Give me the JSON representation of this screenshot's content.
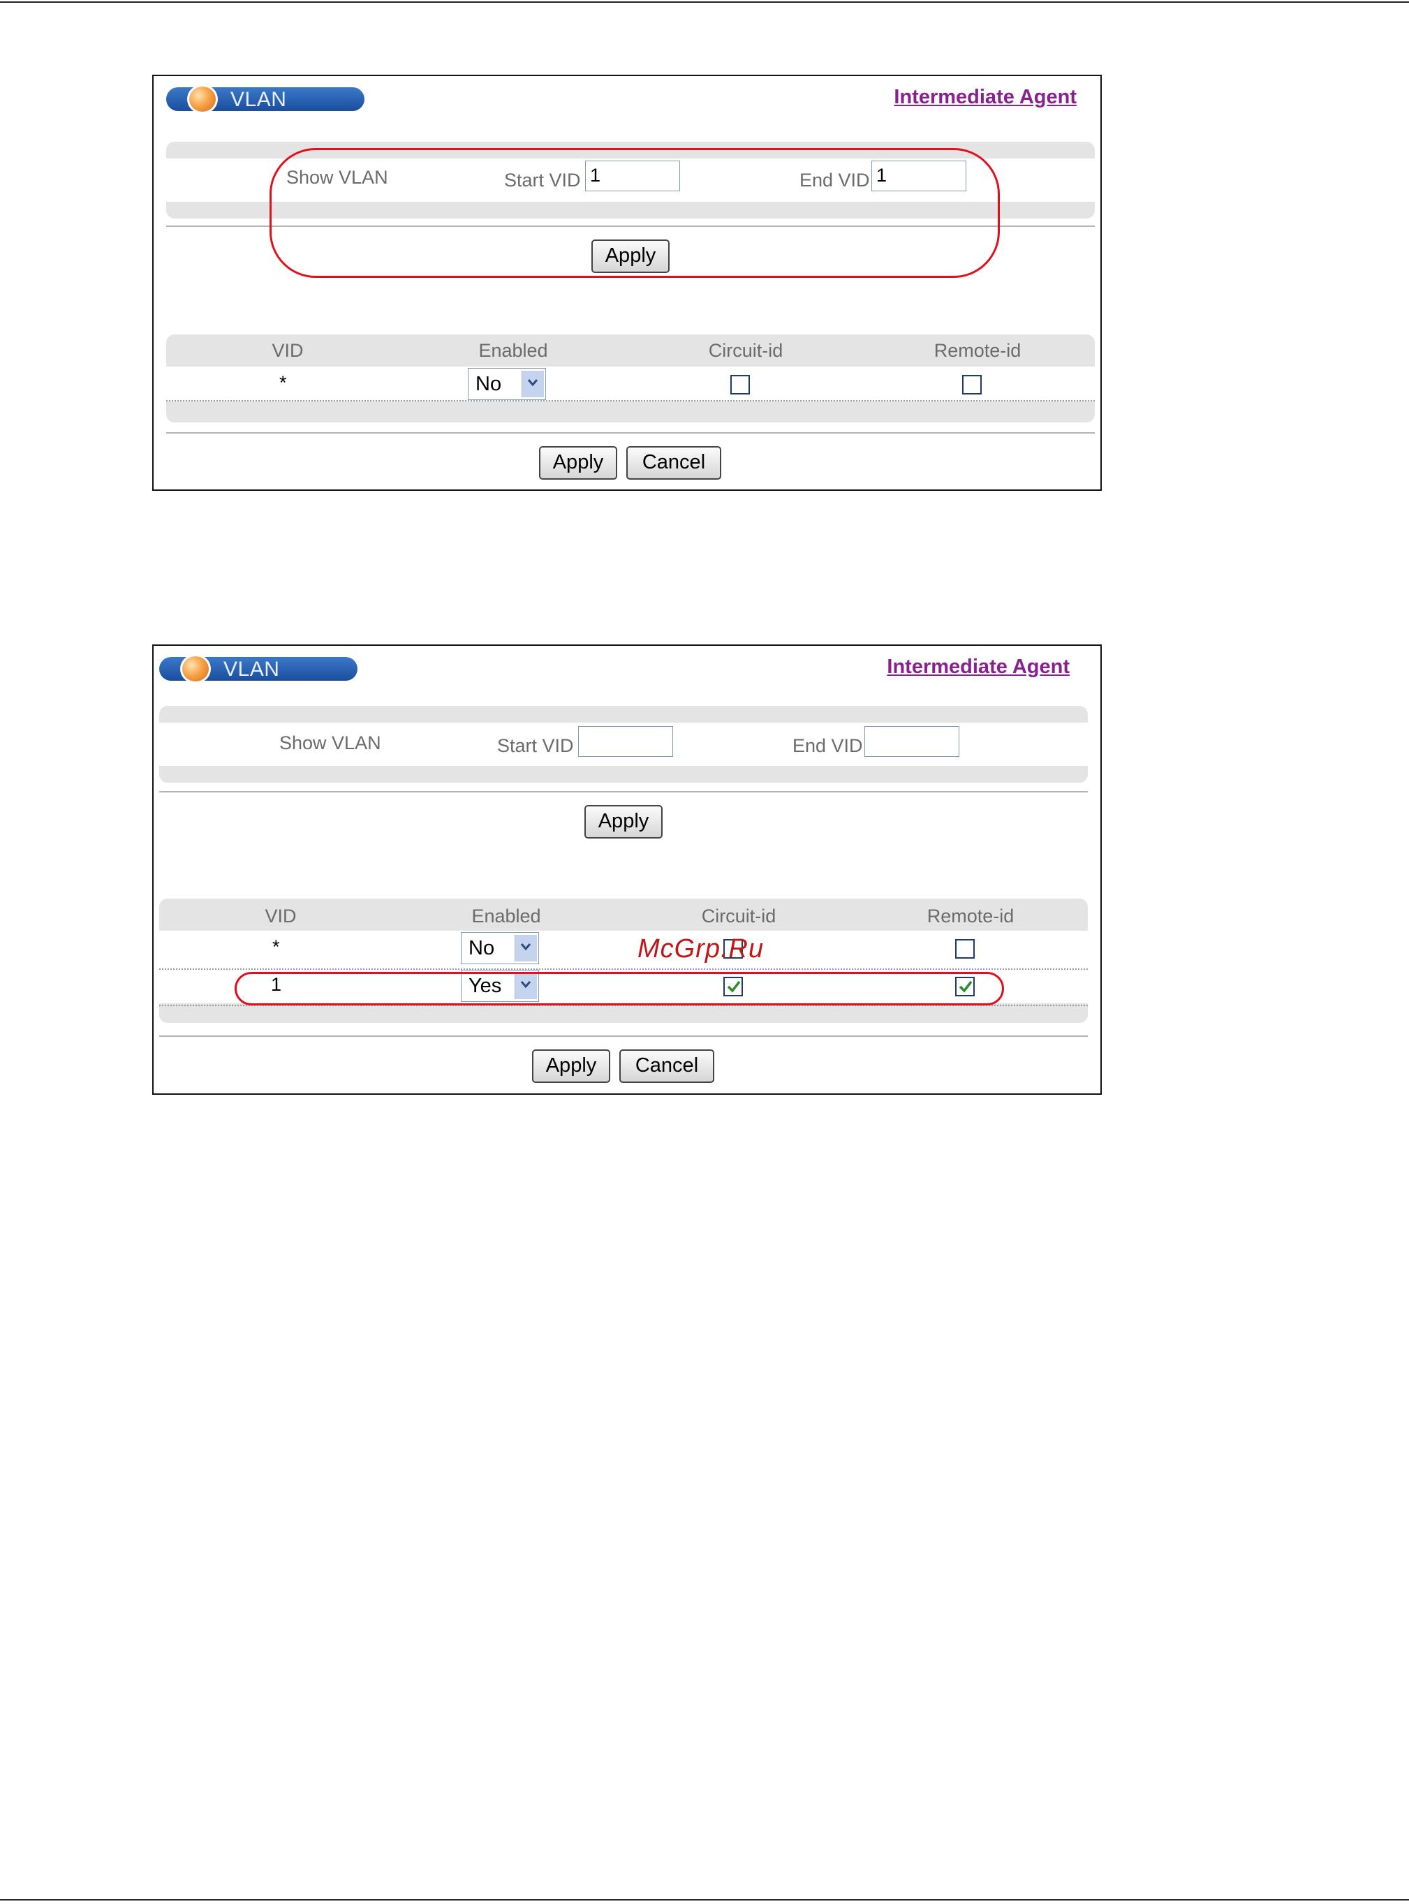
{
  "panels": [
    {
      "header": {
        "title": "VLAN",
        "link": "Intermediate Agent"
      },
      "show_vlan": {
        "label": "Show VLAN",
        "start_label": "Start VID",
        "start_value": "1",
        "end_label": "End VID",
        "end_value": "1",
        "apply": "Apply"
      },
      "table": {
        "columns": [
          "VID",
          "Enabled",
          "Circuit-id",
          "Remote-id"
        ],
        "rows": [
          {
            "vid": "*",
            "enabled": "No",
            "circuit": false,
            "remote": false
          }
        ]
      },
      "buttons": {
        "apply": "Apply",
        "cancel": "Cancel"
      }
    },
    {
      "header": {
        "title": "VLAN",
        "link": "Intermediate Agent"
      },
      "show_vlan": {
        "label": "Show VLAN",
        "start_label": "Start VID",
        "start_value": "",
        "end_label": "End VID",
        "end_value": "",
        "apply": "Apply"
      },
      "table": {
        "columns": [
          "VID",
          "Enabled",
          "Circuit-id",
          "Remote-id"
        ],
        "rows": [
          {
            "vid": "*",
            "enabled": "No",
            "circuit": false,
            "remote": false
          },
          {
            "vid": "1",
            "enabled": "Yes",
            "circuit": true,
            "remote": true
          }
        ]
      },
      "buttons": {
        "apply": "Apply",
        "cancel": "Cancel"
      }
    }
  ],
  "watermark": "McGrp.Ru",
  "colors": {
    "highlight": "#e0101e",
    "link": "#8a2090",
    "header_pill": "#1a4e9e",
    "check": "#2e8b2e"
  }
}
